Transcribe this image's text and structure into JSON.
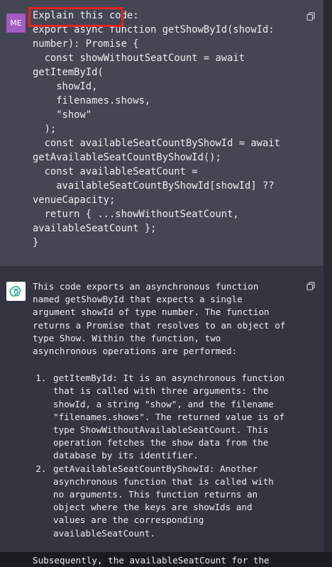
{
  "user_message": {
    "avatar_label": "ME",
    "highlighted_text": "Explain this code:",
    "code_lines": [
      "export async function getShowById(showId:",
      "number): Promise {",
      "  const showWithoutSeatCount = await",
      "getItemById(",
      "    showId,",
      "    filenames.shows,",
      "    \"show\"",
      "  );",
      "  const availableSeatCountByShowId = await",
      "getAvailableSeatCountByShowId();",
      "  const availableSeatCount =",
      "    availableSeatCountByShowId[showId] ??",
      "venueCapacity;",
      "  return { ...showWithoutSeatCount,",
      "availableSeatCount };",
      "}"
    ]
  },
  "assistant_message": {
    "intro": "This code exports an asynchronous function named getShowById that expects a single argument showId of type number. The function returns a Promise that resolves to an object of type Show. Within the function, two asynchronous operations are performed:",
    "items": [
      "getItemById: It is an asynchronous function that is called with three arguments: the showId, a string \"show\", and the filename \"filenames.shows\". The returned value is of type ShowWithoutAvailableSeatCount. This operation fetches the show data from the database by its identifier.",
      "getAvailableSeatCountByShowId: Another asynchronous function that is called with no arguments. This function returns an object where the keys are showIds and values are the corresponding availableSeatCount."
    ],
    "after": "Subsequently, the availableSeatCount for the"
  },
  "icons": {
    "user_copy": "copy-icon",
    "assistant_copy": "copy-icon",
    "assistant_avatar": "openai-logo-icon"
  },
  "colors": {
    "user_bg": "#444654",
    "assistant_bg": "#343541",
    "avatar_bg": "#a35cc0",
    "highlight_border": "#e02424",
    "logo_green": "#10a37f"
  }
}
